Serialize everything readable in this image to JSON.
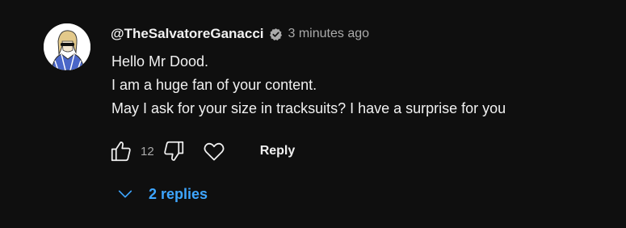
{
  "comment": {
    "author": "@TheSalvatoreGanacci",
    "timestamp": "3 minutes ago",
    "body_lines": [
      "Hello Mr Dood.",
      "I am a huge fan of your content.",
      "May I ask for your size in tracksuits? I have a surprise for you"
    ],
    "like_count": "12",
    "reply_label": "Reply",
    "replies_label": "2 replies"
  },
  "icons": {
    "avatar": "avatar-image",
    "verified": "verified-badge-icon",
    "like": "thumbs-up-icon",
    "dislike": "thumbs-down-icon",
    "heart": "heart-icon",
    "expand": "chevron-down-icon"
  },
  "colors": {
    "background": "#0f0f0f",
    "text": "#f1f1f1",
    "secondary_text": "#aaaaaa",
    "link": "#3ea6ff"
  }
}
